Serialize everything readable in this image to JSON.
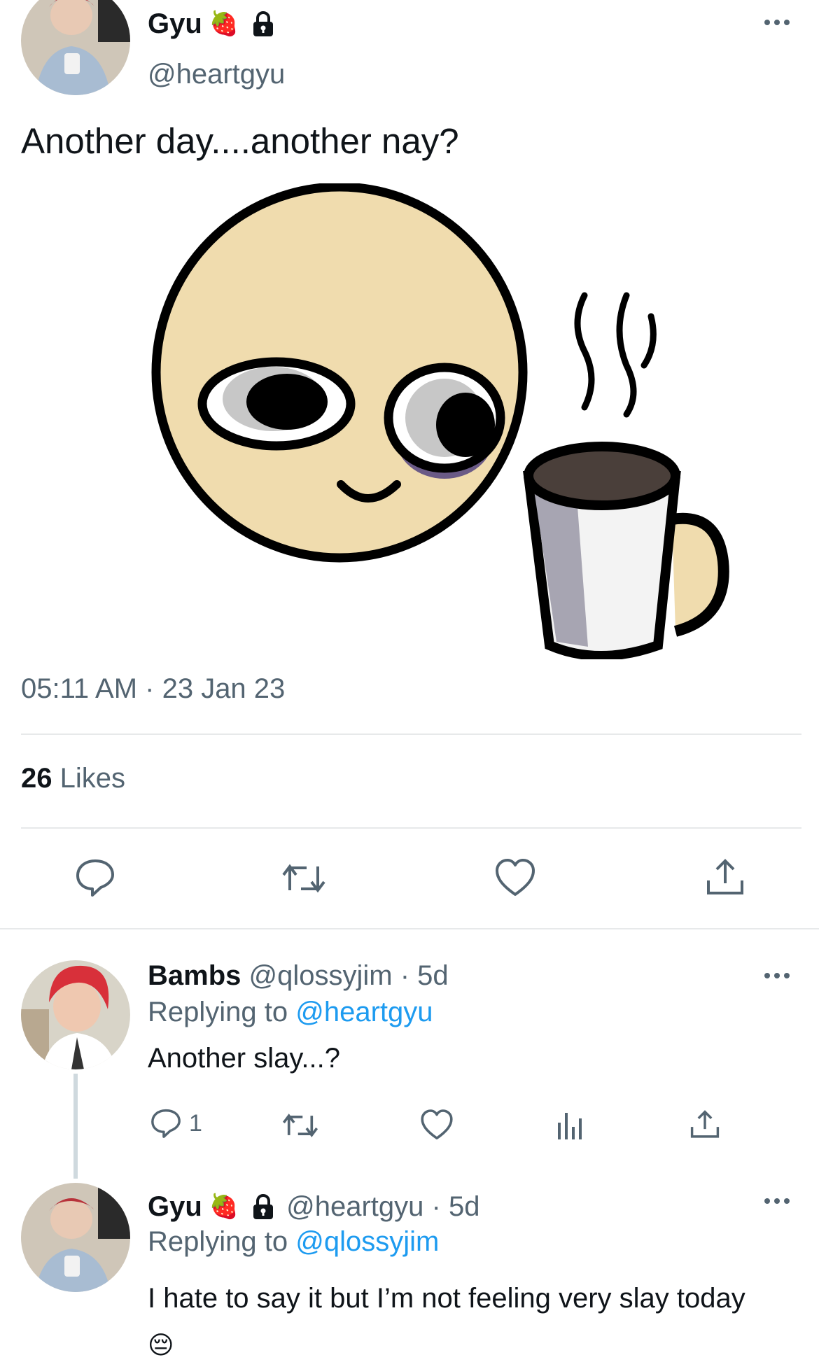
{
  "main_tweet": {
    "display_name": "Gyu",
    "name_emoji": "🍓",
    "handle": "@heartgyu",
    "text": "Another day....another nay?",
    "timestamp": "05:11 AM · 23 Jan 23",
    "likes_count": "26",
    "likes_label": "Likes",
    "media_icon": "tired-face-with-coffee-mug"
  },
  "replies": [
    {
      "display_name": "Bambs",
      "handle_time": "@qlossyjim · 5d",
      "replying_prefix": "Replying to",
      "replying_handle": "@heartgyu",
      "text": "Another slay...?",
      "reply_count": "1"
    },
    {
      "display_name": "Gyu",
      "name_emoji": "🍓",
      "handle_time": "@heartgyu · 5d",
      "replying_prefix": "Replying to",
      "replying_handle": "@qlossyjim",
      "text": "I hate to say it but I’m not feeling very slay today",
      "text_emoji": "😔"
    }
  ],
  "colors": {
    "text": "#0f1419",
    "muted": "#536471",
    "link": "#1d9bf0",
    "divider": "#e7e9ea"
  }
}
